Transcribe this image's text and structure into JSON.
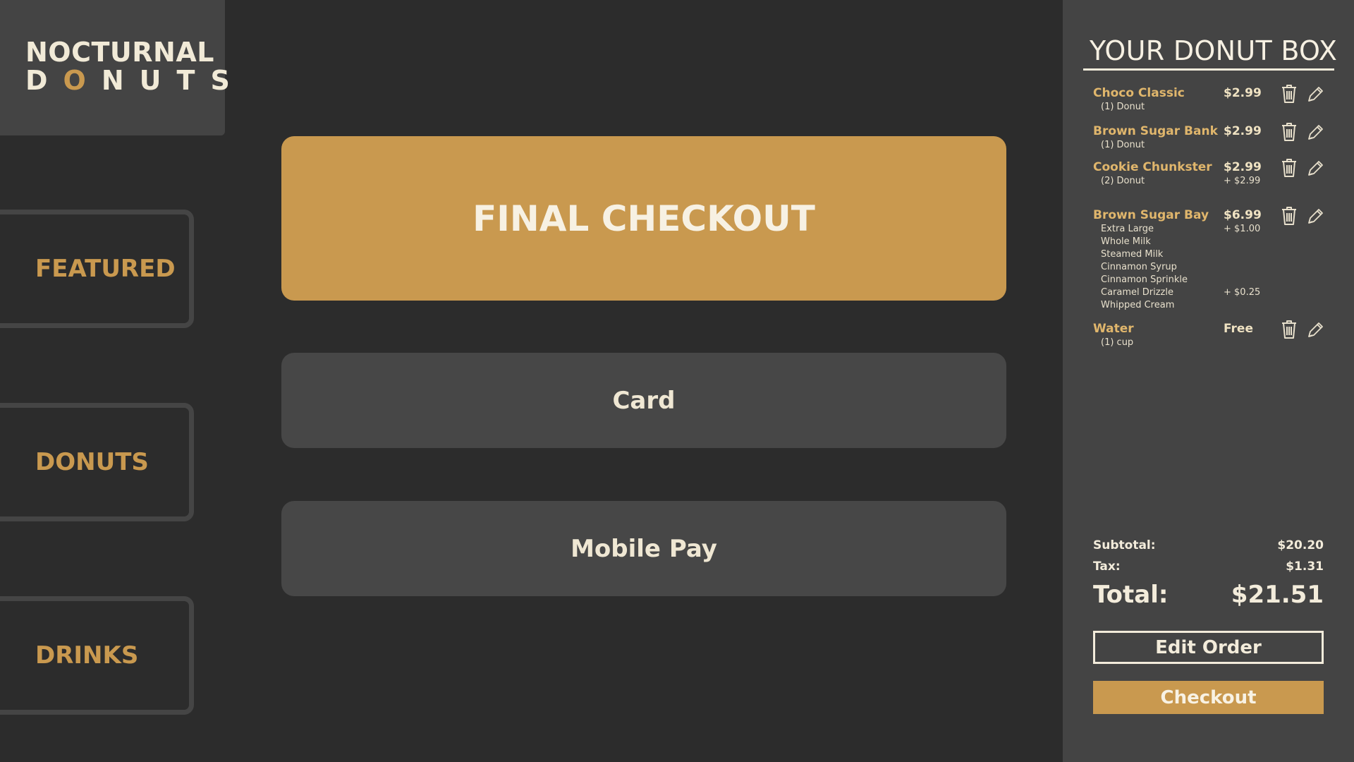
{
  "brand": {
    "line1": "NOCTURNAL",
    "line2_prefix": "D",
    "line2_accent": "O",
    "line2_suffix": "NUTS",
    "accent_color": "#c9994f"
  },
  "nav": {
    "items": [
      {
        "label": "FEATURED"
      },
      {
        "label": "DONUTS"
      },
      {
        "label": "DRINKS"
      }
    ]
  },
  "main": {
    "final_checkout_label": "FINAL CHECKOUT",
    "card_label": "Card",
    "mobile_pay_label": "Mobile Pay"
  },
  "cart": {
    "title": "YOUR DONUT BOX",
    "items": [
      {
        "name": "Choco Classic",
        "price": "$2.99",
        "details": [
          "(1) Donut"
        ],
        "detail_prices": []
      },
      {
        "name": "Brown Sugar Bank",
        "price": "$2.99",
        "details": [
          "(1) Donut"
        ],
        "detail_prices": []
      },
      {
        "name": "Cookie Chunkster",
        "price": "$2.99",
        "details": [
          "(2) Donut"
        ],
        "detail_prices": [
          "+ $2.99"
        ]
      },
      {
        "name": "Brown Sugar Bay",
        "price": "$6.99",
        "details": [
          "Extra Large",
          "Whole Milk",
          "Steamed Milk",
          "Cinnamon Syrup",
          "Cinnamon Sprinkle",
          "Caramel Drizzle",
          "Whipped Cream"
        ],
        "detail_prices": [
          "+ $1.00",
          "",
          "",
          "",
          "",
          "+ $0.25",
          ""
        ]
      },
      {
        "name": "Water",
        "price": "Free",
        "details": [
          "(1) cup"
        ],
        "detail_prices": []
      }
    ],
    "icons": {
      "delete": "trash-icon",
      "edit": "pencil-icon"
    },
    "subtotal_label": "Subtotal:",
    "subtotal_value": "$20.20",
    "tax_label": "Tax:",
    "tax_value": "$1.31",
    "total_label": "Total:",
    "total_value": "$21.51",
    "edit_order_label": "Edit Order",
    "checkout_label": "Checkout"
  }
}
